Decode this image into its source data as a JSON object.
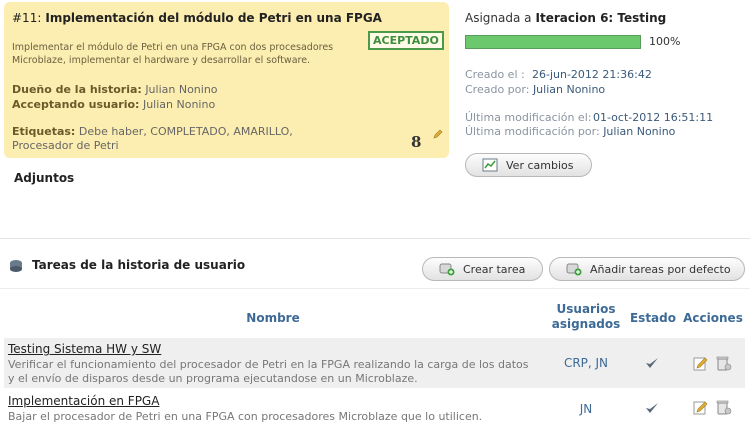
{
  "story": {
    "ref": "#11:",
    "title": "Implementación del módulo de Petri en una FPGA",
    "status": "ACEPTADO",
    "description": "Implementar el módulo de Petri en una FPGA con dos procesadores Microblaze, implementar el hardware y desarrollar el software.",
    "owner_label": "Dueño de la historia:",
    "owner": "Julian Nonino",
    "accepting_label": "Acceptando usuario:",
    "accepting": "Julian Nonino",
    "tags_label": "Etiquetas:",
    "tags": "Debe haber, COMPLETADO, AMARILLO, Procesador de Petri",
    "points": "8",
    "colors": {
      "card_bg": "#fcedb0",
      "status_green": "#3e8e3e"
    }
  },
  "attachments": {
    "title": "Adjuntos"
  },
  "sidebar": {
    "assigned_label": "Asignada a",
    "assigned_value": "Iteracion 6: Testing",
    "progress_percent": 100,
    "progress_label": "100%",
    "created_label": "Creado el :",
    "created_value": "26-jun-2012 21:36:42",
    "created_by_label": "Creado por:",
    "created_by_value": "Julian Nonino",
    "modified_label": "Última modificación el:",
    "modified_value": "01-oct-2012 16:51:11",
    "modified_by_label": "Última modificación por:",
    "modified_by_value": "Julian Nonino",
    "view_changes_label": "Ver cambios"
  },
  "tasks": {
    "title": "Tareas de la historia de usuario",
    "create_label": "Crear tarea",
    "add_default_label": "Añadir tareas por defecto",
    "columns": {
      "name": "Nombre",
      "users": "Usuarios asignados",
      "state": "Estado",
      "actions": "Acciones"
    },
    "rows": [
      {
        "name": "Testing Sistema HW y SW",
        "description": "Verificar el funcionamiento del procesador de Petri en la FPGA realizando la carga de los datos y el envío de disparos desde un programa ejecutandose en un Microblaze.",
        "users": "CRP, JN",
        "state_icon": "check-icon"
      },
      {
        "name": "Implementación en FPGA",
        "description": "Bajar el procesador de Petri en una FPGA con procesadores Microblaze que lo utilicen.",
        "users": "JN",
        "state_icon": "check-icon"
      }
    ]
  }
}
